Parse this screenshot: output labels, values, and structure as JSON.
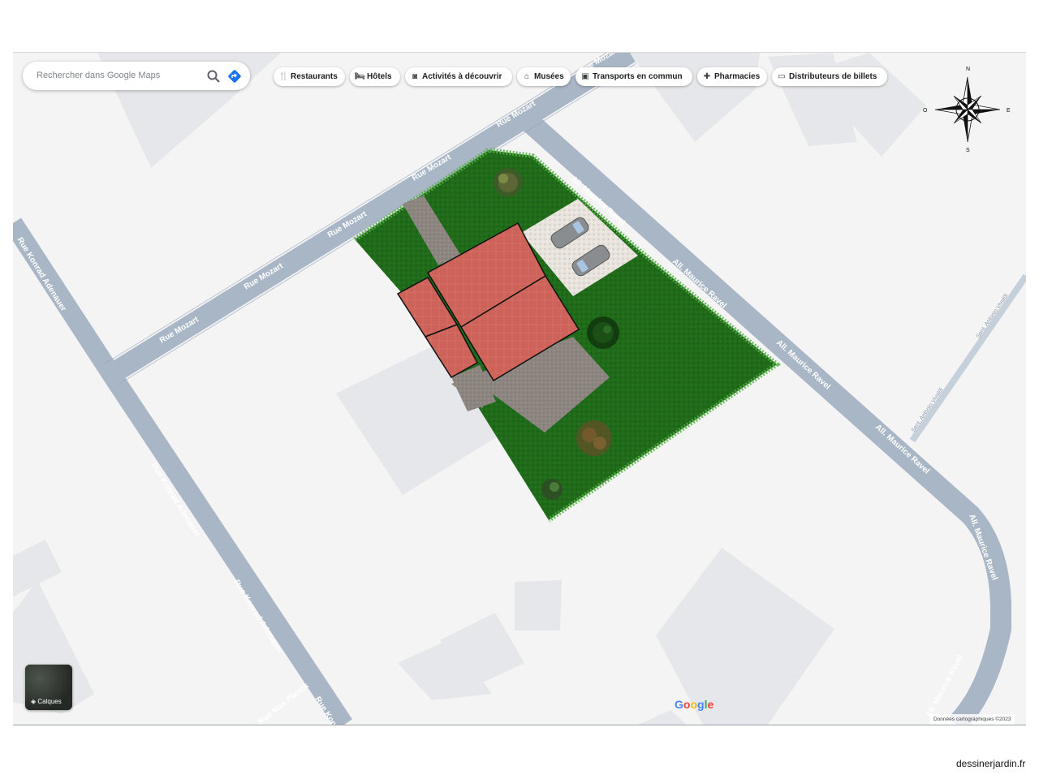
{
  "search": {
    "placeholder": "Rechercher dans Google Maps",
    "search_icon": "magnifier-icon",
    "directions_icon": "directions-icon"
  },
  "chips": [
    {
      "label": "Restaurants",
      "icon": "fork-knife-icon"
    },
    {
      "label": "Hôtels",
      "icon": "bed-icon"
    },
    {
      "label": "Activités à découvrir",
      "icon": "camera-icon"
    },
    {
      "label": "Musées",
      "icon": "museum-icon"
    },
    {
      "label": "Transports en commun",
      "icon": "bus-icon"
    },
    {
      "label": "Pharmacies",
      "icon": "pharmacy-icon"
    },
    {
      "label": "Distributeurs de billets",
      "icon": "atm-icon"
    }
  ],
  "compass": {
    "n": "N",
    "s": "S",
    "e": "E",
    "o": "O"
  },
  "streets": {
    "mozart": "Rue Mozart",
    "ravel": "All. Maurice Ravel",
    "adenauer": "Rue Konrad Adenauer",
    "antonio": "Sent. Antonio Vivaldi",
    "planck": "Rue Max Planck"
  },
  "layers_label": "Calques",
  "google_logo": "Google",
  "attribution": "Données cartographiques ©2023",
  "site_credit": "dessinerjardin.fr",
  "colors": {
    "road": "#a8b6c6",
    "block": "#e6e7ea",
    "lawn": "#1f6b1a",
    "roof": "#cd6259",
    "paving": "#8d8580",
    "gravel": "#e2ddd6"
  }
}
